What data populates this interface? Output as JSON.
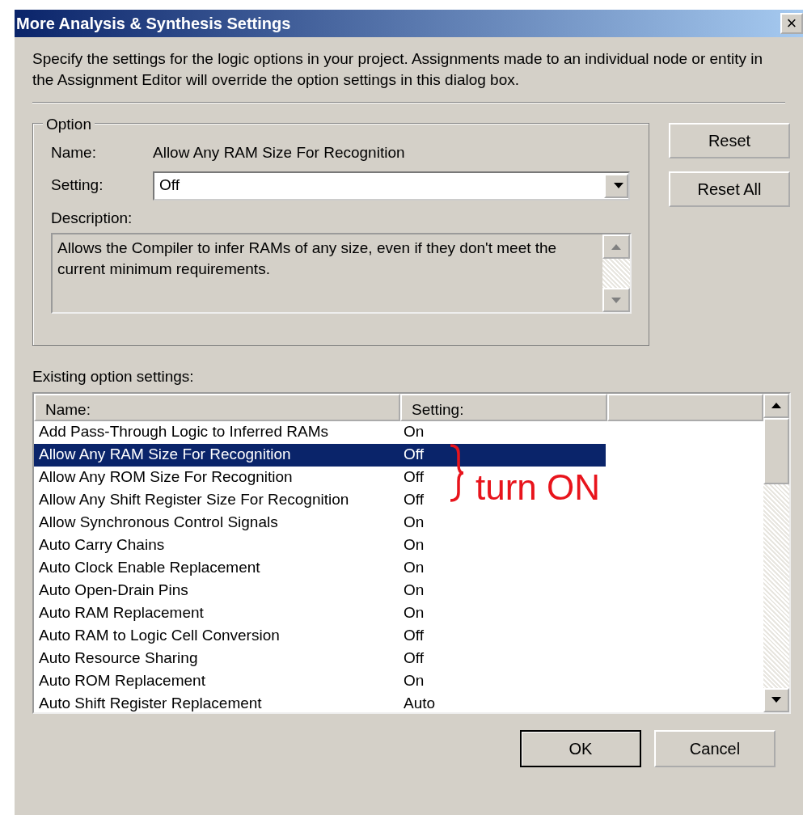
{
  "window": {
    "title": "More Analysis & Synthesis Settings",
    "close": "×"
  },
  "intro": "Specify the settings for the logic options in your project.  Assignments made to an individual node or entity in the Assignment Editor will override the option settings in this dialog box.",
  "option": {
    "group_title": "Option",
    "name_label": "Name:",
    "name_value": "Allow Any RAM Size For Recognition",
    "setting_label": "Setting:",
    "setting_value": "Off",
    "description_label": "Description:",
    "description": "Allows the Compiler to infer RAMs of any size, even if they don't meet the current minimum requirements."
  },
  "side_buttons": [
    "Reset",
    "Reset All"
  ],
  "existing_label": "Existing option settings:",
  "table": {
    "columns": [
      "Name:",
      "Setting:"
    ],
    "rows": [
      {
        "name": "Add Pass-Through Logic to Inferred RAMs",
        "setting": "On",
        "selected": false
      },
      {
        "name": "Allow Any RAM Size For Recognition",
        "setting": "Off",
        "selected": true
      },
      {
        "name": "Allow Any ROM Size For Recognition",
        "setting": "Off",
        "selected": false
      },
      {
        "name": "Allow Any Shift Register Size For Recognition",
        "setting": "Off",
        "selected": false
      },
      {
        "name": "Allow Synchronous Control Signals",
        "setting": "On",
        "selected": false
      },
      {
        "name": "Auto Carry Chains",
        "setting": "On",
        "selected": false
      },
      {
        "name": "Auto Clock Enable Replacement",
        "setting": "On",
        "selected": false
      },
      {
        "name": "Auto Open-Drain Pins",
        "setting": "On",
        "selected": false
      },
      {
        "name": "Auto RAM Replacement",
        "setting": "On",
        "selected": false
      },
      {
        "name": "Auto RAM to Logic Cell Conversion",
        "setting": "Off",
        "selected": false
      },
      {
        "name": "Auto Resource Sharing",
        "setting": "Off",
        "selected": false
      },
      {
        "name": "Auto ROM Replacement",
        "setting": "On",
        "selected": false
      },
      {
        "name": "Auto Shift Register Replacement",
        "setting": "Auto",
        "selected": false
      }
    ]
  },
  "annotation": {
    "text": "turn ON",
    "color": "#e8141c"
  },
  "buttons": [
    "OK",
    "Cancel"
  ]
}
